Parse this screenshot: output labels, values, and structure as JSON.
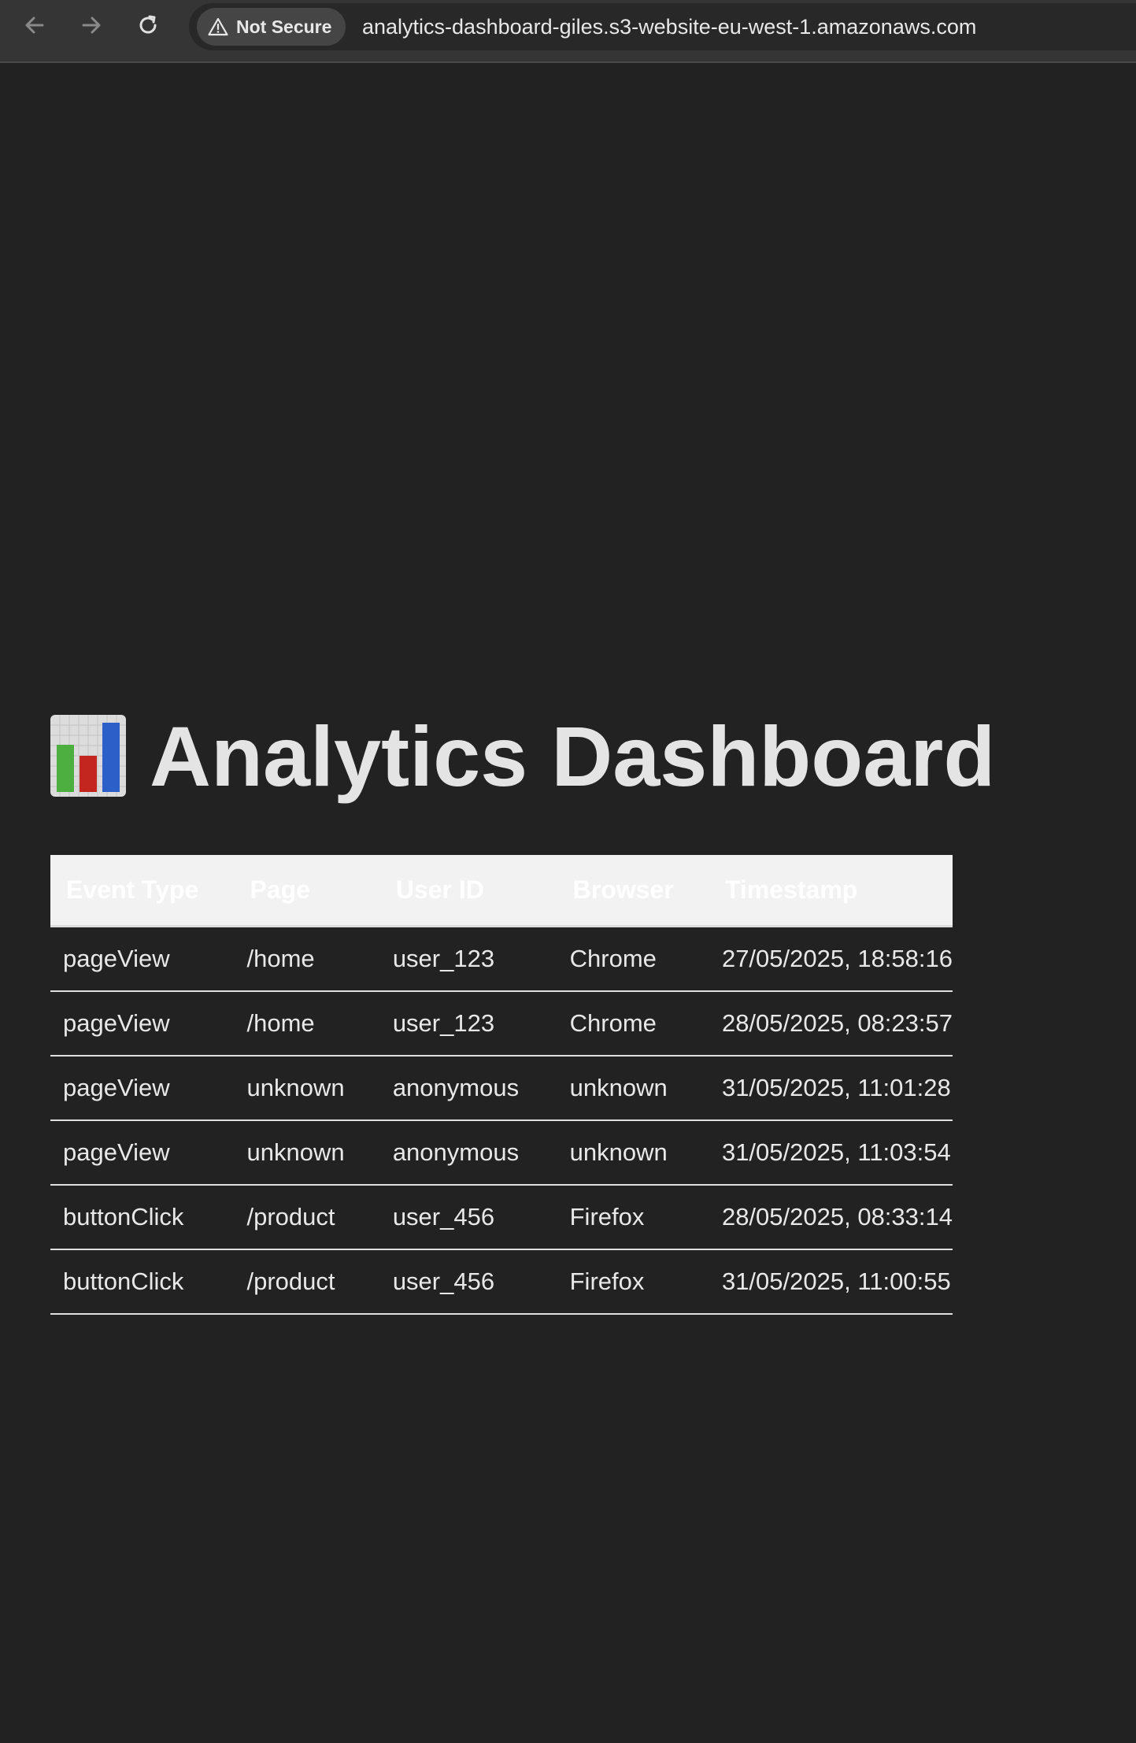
{
  "browser": {
    "security_label": "Not Secure",
    "url": "analytics-dashboard-giles.s3-website-eu-west-1.amazonaws.com",
    "icons": [
      "back-arrow-icon",
      "forward-arrow-icon",
      "reload-icon",
      "warning-triangle-icon"
    ]
  },
  "page": {
    "title": "Analytics Dashboard",
    "title_icon": "bar-chart-emoji-icon"
  },
  "table": {
    "headers": {
      "event_type": "Event Type",
      "page": "Page",
      "user_id": "User ID",
      "browser": "Browser",
      "timestamp": "Timestamp"
    },
    "rows": [
      {
        "event_type": "pageView",
        "page": "/home",
        "user_id": "user_123",
        "browser": "Chrome",
        "timestamp": "27/05/2025, 18:58:16"
      },
      {
        "event_type": "pageView",
        "page": "/home",
        "user_id": "user_123",
        "browser": "Chrome",
        "timestamp": "28/05/2025, 08:23:57"
      },
      {
        "event_type": "pageView",
        "page": "unknown",
        "user_id": "anonymous",
        "browser": "unknown",
        "timestamp": "31/05/2025, 11:01:28"
      },
      {
        "event_type": "pageView",
        "page": "unknown",
        "user_id": "anonymous",
        "browser": "unknown",
        "timestamp": "31/05/2025, 11:03:54"
      },
      {
        "event_type": "buttonClick",
        "page": "/product",
        "user_id": "user_456",
        "browser": "Firefox",
        "timestamp": "28/05/2025, 08:33:14"
      },
      {
        "event_type": "buttonClick",
        "page": "/product",
        "user_id": "user_456",
        "browser": "Firefox",
        "timestamp": "31/05/2025, 11:00:55"
      }
    ]
  },
  "colors": {
    "page_background": "#222222",
    "header_background": "#f2f2f2",
    "text": "#e8e8e8"
  }
}
